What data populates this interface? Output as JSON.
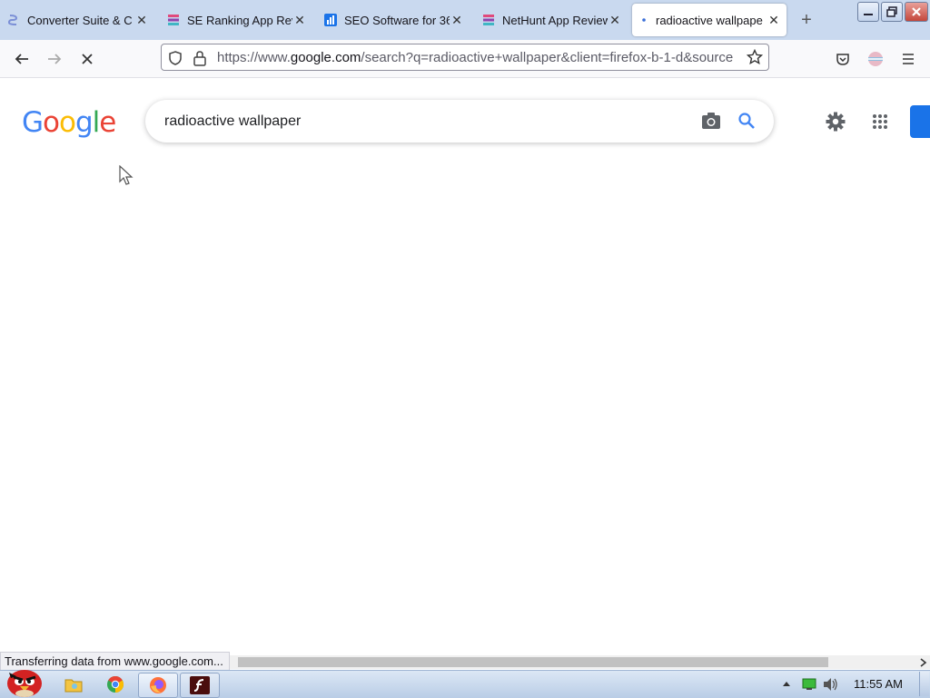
{
  "browser": {
    "tabs": [
      {
        "title": "Converter Suite & C",
        "active": false,
        "icon": "converter-suite-favicon"
      },
      {
        "title": "SE Ranking App Revi",
        "active": false,
        "icon": "stack-favicon"
      },
      {
        "title": "SEO Software for 36",
        "active": false,
        "icon": "bar-chart-favicon"
      },
      {
        "title": "NetHunt App Review",
        "active": false,
        "icon": "stack-favicon"
      },
      {
        "title": "radioactive wallpape",
        "active": true,
        "icon": "loading-dot"
      }
    ],
    "new_tab": "+",
    "url": {
      "prefix": "https://www.",
      "domain": "google.com",
      "rest": "/search?q=radioactive+wallpaper&client=firefox-b-1-d&source"
    }
  },
  "google": {
    "logo": "Google",
    "logo_colors": [
      "#4285F4",
      "#EA4335",
      "#FBBC05",
      "#4285F4",
      "#34A853",
      "#EA4335"
    ],
    "query": "radioactive wallpaper"
  },
  "status_bar": "Transferring data from www.google.com...",
  "taskbar": {
    "clock": "11:55 AM"
  }
}
